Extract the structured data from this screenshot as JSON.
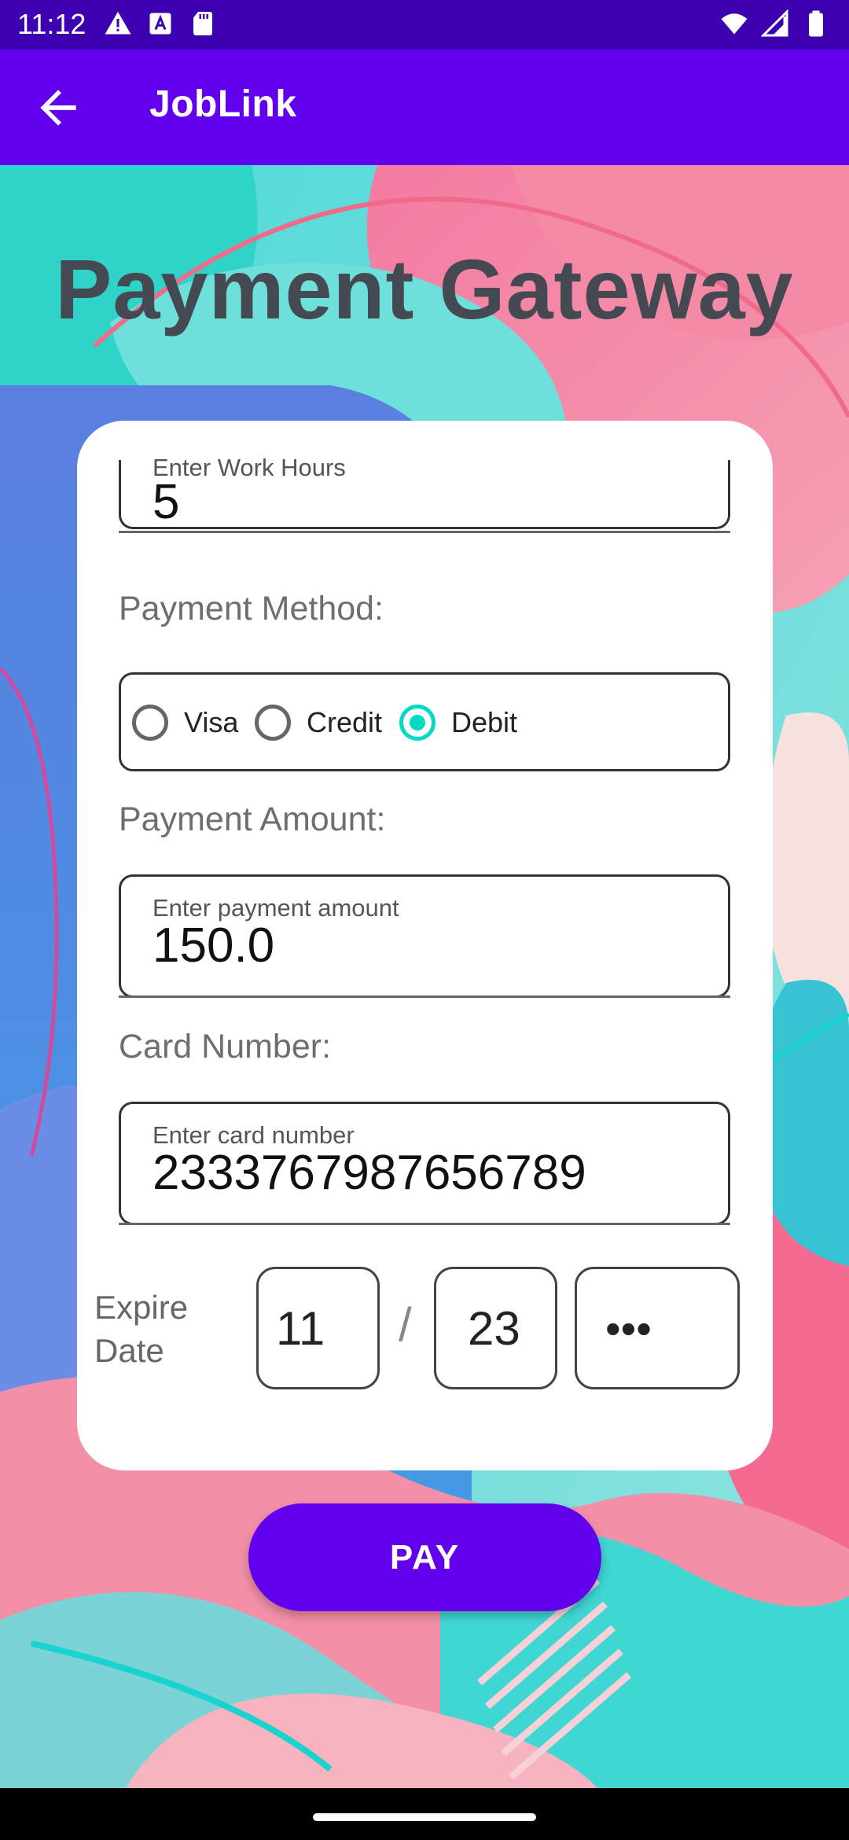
{
  "status_bar": {
    "time": "11:12",
    "left_icons": [
      "alert-icon",
      "text-a-icon",
      "sd-card-icon"
    ],
    "right_icons": [
      "wifi-icon",
      "signal-icon",
      "battery-icon"
    ]
  },
  "app_bar": {
    "title": "JobLink",
    "back_icon": "arrow-back-icon",
    "color": "#6200ee"
  },
  "page": {
    "heading": "Payment Gateway"
  },
  "form": {
    "work_hours": {
      "label": "Enter Work Hours",
      "value": "5"
    },
    "payment_method": {
      "label": "Payment Method:",
      "options": [
        {
          "label": "Visa",
          "checked": false
        },
        {
          "label": "Credit",
          "checked": false
        },
        {
          "label": "Debit",
          "checked": true
        }
      ],
      "accent_color": "#03dac5"
    },
    "payment_amount": {
      "section_label": "Payment Amount:",
      "field_label": "Enter payment amount",
      "value": "150.0"
    },
    "card_number": {
      "section_label": "Card Number:",
      "field_label": "Enter card number",
      "value": "2333767987656789"
    },
    "expire": {
      "label_line1": "Expire",
      "label_line2": "Date",
      "month": "11",
      "separator": "/",
      "year": "23",
      "cvv_masked": "•••"
    }
  },
  "pay_button": {
    "label": "PAY"
  }
}
